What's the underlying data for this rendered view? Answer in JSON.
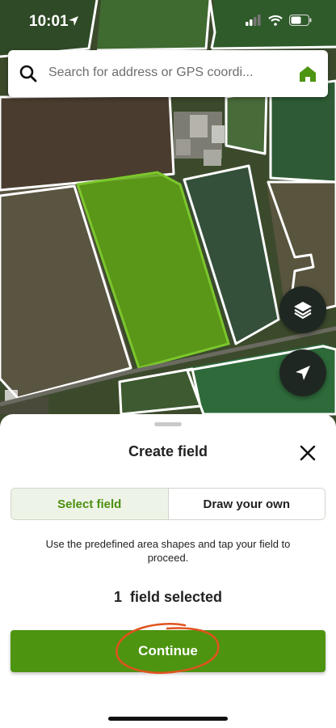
{
  "status_bar": {
    "time": "10:01"
  },
  "search": {
    "placeholder": "Search for address or GPS coordi..."
  },
  "sheet": {
    "title": "Create field",
    "tabs": [
      {
        "label": "Select field",
        "active": true
      },
      {
        "label": "Draw your own",
        "active": false
      }
    ],
    "hint": "Use the predefined area shapes and tap your field to proceed.",
    "selected_count": "1  field selected",
    "continue_label": "Continue"
  },
  "colors": {
    "accent": "#4d9410",
    "selected_field": "#5fa016",
    "annotation": "#e0531f"
  },
  "icons": [
    "location-arrow-icon",
    "signal-icon",
    "wifi-icon",
    "battery-icon",
    "search-icon",
    "home-icon",
    "layers-icon",
    "navigation-icon",
    "close-icon"
  ]
}
